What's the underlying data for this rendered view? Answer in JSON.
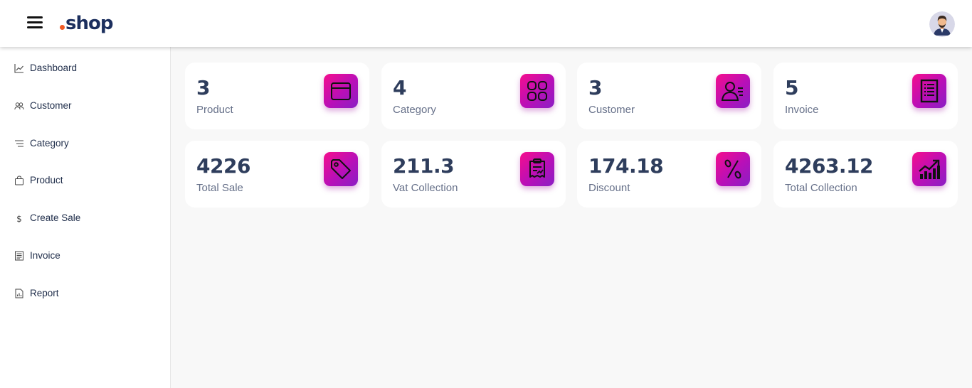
{
  "header": {
    "logo_text": "shop",
    "brand_dot_color": "#f15a24",
    "brand_text_color": "#1c2f5e"
  },
  "sidebar": {
    "items": [
      {
        "label": "Dashboard",
        "icon": "chart-line-icon"
      },
      {
        "label": "Customer",
        "icon": "users-icon"
      },
      {
        "label": "Category",
        "icon": "list-lines-icon"
      },
      {
        "label": "Product",
        "icon": "bag-icon"
      },
      {
        "label": "Create Sale",
        "icon": "dollar-icon"
      },
      {
        "label": "Invoice",
        "icon": "invoice-icon"
      },
      {
        "label": "Report",
        "icon": "report-icon"
      }
    ]
  },
  "cards": [
    {
      "value": "3",
      "label": "Product",
      "icon": "box-icon"
    },
    {
      "value": "4",
      "label": "Category",
      "icon": "grid-icon"
    },
    {
      "value": "3",
      "label": "Customer",
      "icon": "user-card-icon"
    },
    {
      "value": "5",
      "label": "Invoice",
      "icon": "document-icon"
    },
    {
      "value": "4226",
      "label": "Total Sale",
      "icon": "tag-icon"
    },
    {
      "value": "211.3",
      "label": "Vat Collection",
      "icon": "receipt-icon"
    },
    {
      "value": "174.18",
      "label": "Discount",
      "icon": "percent-icon"
    },
    {
      "value": "4263.12",
      "label": "Total Collection",
      "icon": "trending-up-icon"
    }
  ],
  "colors": {
    "card_icon_gradient": [
      "#f50d8c",
      "#b80fb8",
      "#8a1fc4"
    ],
    "background": "#f8f8f8",
    "value_text": "#2e3d5c"
  }
}
